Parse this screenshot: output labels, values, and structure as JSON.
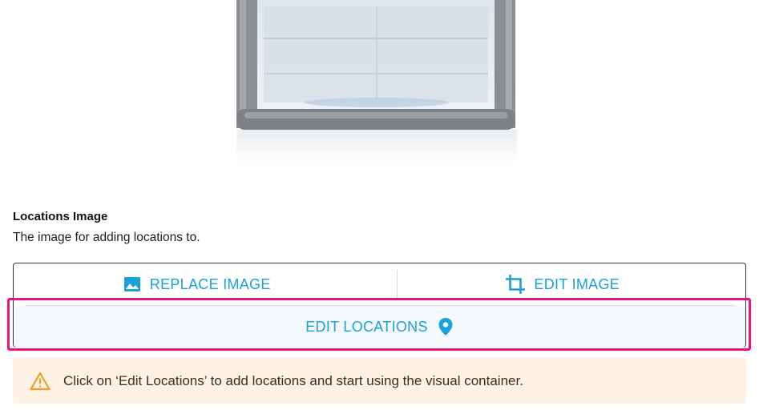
{
  "locations_image": {
    "title": "Locations Image",
    "description": "The image for adding locations to."
  },
  "actions": {
    "replace_image": {
      "label": "REPLACE IMAGE",
      "icon": "image-icon"
    },
    "edit_image": {
      "label": "EDIT IMAGE",
      "icon": "crop-icon"
    },
    "edit_locations": {
      "label": "EDIT LOCATIONS",
      "icon": "location-pin-icon"
    }
  },
  "warning": {
    "icon": "warning-triangle-icon",
    "text": "Click on ‘Edit Locations’ to add locations and start using the visual container."
  },
  "colors": {
    "accent": "#1aa1d8",
    "highlight": "#e9157c",
    "warning_bg": "#fdf2e3",
    "warning_icon": "#f0a020"
  }
}
